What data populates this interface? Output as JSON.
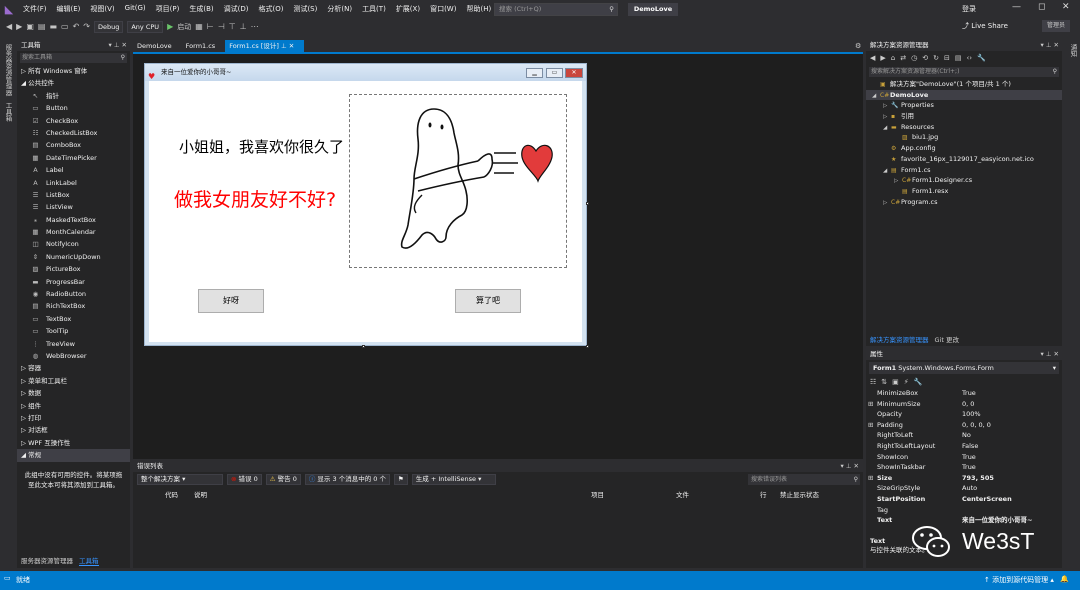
{
  "menubar": {
    "items": [
      "文件(F)",
      "编辑(E)",
      "视图(V)",
      "Git(G)",
      "项目(P)",
      "生成(B)",
      "调试(D)",
      "格式(O)",
      "测试(S)",
      "分析(N)",
      "工具(T)",
      "扩展(X)",
      "窗口(W)",
      "帮助(H)"
    ],
    "search_placeholder": "搜索 (Ctrl+Q)",
    "solution_name": "DemoLove",
    "login": "登录"
  },
  "toolbar": {
    "config": "Debug",
    "platform": "Any CPU",
    "start": "启动",
    "liveshare": "Live Share",
    "admin": "管理员"
  },
  "left_vtabs": [
    "服务器资源管理器",
    "工具箱"
  ],
  "toolbox": {
    "title": "工具箱",
    "search_placeholder": "搜索工具箱",
    "rows": [
      {
        "type": "cat",
        "label": "▷ 所有 Windows 窗体"
      },
      {
        "type": "cat",
        "label": "◢ 公共控件"
      },
      {
        "type": "item",
        "icon": "↖",
        "label": "指针"
      },
      {
        "type": "item",
        "icon": "▭",
        "label": "Button"
      },
      {
        "type": "item",
        "icon": "☑",
        "label": "CheckBox"
      },
      {
        "type": "item",
        "icon": "☷",
        "label": "CheckedListBox"
      },
      {
        "type": "item",
        "icon": "▤",
        "label": "ComboBox"
      },
      {
        "type": "item",
        "icon": "▦",
        "label": "DateTimePicker"
      },
      {
        "type": "item",
        "icon": "A",
        "label": "Label"
      },
      {
        "type": "item",
        "icon": "A",
        "label": "LinkLabel"
      },
      {
        "type": "item",
        "icon": "☰",
        "label": "ListBox"
      },
      {
        "type": "item",
        "icon": "☰",
        "label": "ListView"
      },
      {
        "type": "item",
        "icon": "⁎",
        "label": "MaskedTextBox"
      },
      {
        "type": "item",
        "icon": "▦",
        "label": "MonthCalendar"
      },
      {
        "type": "item",
        "icon": "◫",
        "label": "NotifyIcon"
      },
      {
        "type": "item",
        "icon": "⇕",
        "label": "NumericUpDown"
      },
      {
        "type": "item",
        "icon": "▨",
        "label": "PictureBox"
      },
      {
        "type": "item",
        "icon": "▬",
        "label": "ProgressBar"
      },
      {
        "type": "item",
        "icon": "◉",
        "label": "RadioButton"
      },
      {
        "type": "item",
        "icon": "▤",
        "label": "RichTextBox"
      },
      {
        "type": "item",
        "icon": "▭",
        "label": "TextBox"
      },
      {
        "type": "item",
        "icon": "▭",
        "label": "ToolTip"
      },
      {
        "type": "item",
        "icon": "⋮",
        "label": "TreeView"
      },
      {
        "type": "item",
        "icon": "◍",
        "label": "WebBrowser"
      },
      {
        "type": "cat",
        "label": "▷ 容器"
      },
      {
        "type": "cat",
        "label": "▷ 菜单和工具栏"
      },
      {
        "type": "cat",
        "label": "▷ 数据"
      },
      {
        "type": "cat",
        "label": "▷ 组件"
      },
      {
        "type": "cat",
        "label": "▷ 打印"
      },
      {
        "type": "cat",
        "label": "▷ 对话框"
      },
      {
        "type": "cat",
        "label": "▷ WPF 互操作性"
      },
      {
        "type": "cat",
        "label": "◢ 常规",
        "selected": true
      }
    ],
    "note": "此组中没有可用的控件。将某项拖至此文本可将其添加到工具箱。",
    "bottom_tabs": [
      "服务器资源管理器",
      "工具箱"
    ]
  },
  "doc_tabs": [
    "DemoLove",
    "Form1.cs",
    "Form1.cs [设计]"
  ],
  "form": {
    "title": "来自一位爱你的小哥哥~",
    "label1": "小姐姐，我喜欢你很久了",
    "label2": "做我女朋友好不好?",
    "button_ok": "好呀",
    "button_no": "算了吧"
  },
  "error_list": {
    "title": "错误列表",
    "scope": "整个解决方案",
    "errors": "错误 0",
    "warnings": "警告 0",
    "messages": "显示 3 个消息中的 0 个",
    "build": "生成 + IntelliSense",
    "search_placeholder": "搜索错误列表",
    "columns": [
      "代码",
      "说明",
      "项目",
      "文件",
      "行",
      "禁止显示状态"
    ]
  },
  "solution_explorer": {
    "title": "解决方案资源管理器",
    "search_placeholder": "搜索解决方案资源管理器(Ctrl+;)",
    "tree": [
      {
        "indent": 0,
        "arrow": "",
        "icon": "▣",
        "label": "解决方案\"DemoLove\"(1 个项目/共 1 个)"
      },
      {
        "indent": 0,
        "arrow": "◢",
        "icon": "C#",
        "label": "DemoLove",
        "bold": true,
        "selected": true
      },
      {
        "indent": 1,
        "arrow": "▷",
        "icon": "🔧",
        "label": "Properties"
      },
      {
        "indent": 1,
        "arrow": "▷",
        "icon": "▪",
        "label": "引用"
      },
      {
        "indent": 1,
        "arrow": "◢",
        "icon": "▬",
        "label": "Resources"
      },
      {
        "indent": 2,
        "arrow": "",
        "icon": "▨",
        "label": "biu1.jpg"
      },
      {
        "indent": 1,
        "arrow": "",
        "icon": "⚙",
        "label": "App.config"
      },
      {
        "indent": 1,
        "arrow": "",
        "icon": "★",
        "label": "favorite_16px_1129017_easyicon.net.ico"
      },
      {
        "indent": 1,
        "arrow": "◢",
        "icon": "▤",
        "label": "Form1.cs"
      },
      {
        "indent": 2,
        "arrow": "▷",
        "icon": "C#",
        "label": "Form1.Designer.cs"
      },
      {
        "indent": 2,
        "arrow": "",
        "icon": "▤",
        "label": "Form1.resx"
      },
      {
        "indent": 1,
        "arrow": "▷",
        "icon": "C#",
        "label": "Program.cs"
      }
    ],
    "bottom_tabs": [
      "解决方案资源管理器",
      "Git 更改"
    ]
  },
  "properties": {
    "title": "属性",
    "object": "Form1",
    "object_type": "System.Windows.Forms.Form",
    "rows": [
      {
        "exp": "",
        "name": "MinimizeBox",
        "value": "True"
      },
      {
        "exp": "⊞",
        "name": "MinimumSize",
        "value": "0, 0"
      },
      {
        "exp": "",
        "name": "Opacity",
        "value": "100%"
      },
      {
        "exp": "⊞",
        "name": "Padding",
        "value": "0, 0, 0, 0"
      },
      {
        "exp": "",
        "name": "RightToLeft",
        "value": "No"
      },
      {
        "exp": "",
        "name": "RightToLeftLayout",
        "value": "False"
      },
      {
        "exp": "",
        "name": "ShowIcon",
        "value": "True"
      },
      {
        "exp": "",
        "name": "ShowInTaskbar",
        "value": "True"
      },
      {
        "exp": "⊞",
        "name": "Size",
        "value": "793, 505",
        "bold": true
      },
      {
        "exp": "",
        "name": "SizeGripStyle",
        "value": "Auto"
      },
      {
        "exp": "",
        "name": "StartPosition",
        "value": "CenterScreen",
        "bold": true
      },
      {
        "exp": "",
        "name": "Tag",
        "value": ""
      },
      {
        "exp": "",
        "name": "Text",
        "value": "来自一位爱你的小哥哥~",
        "bold": true
      }
    ],
    "desc_title": "Text",
    "desc_text": "与控件关联的文本。"
  },
  "right_vtabs": [
    "通知"
  ],
  "status": {
    "left": "就绪",
    "right": "添加到源代码管理"
  },
  "watermark": "We3sT"
}
